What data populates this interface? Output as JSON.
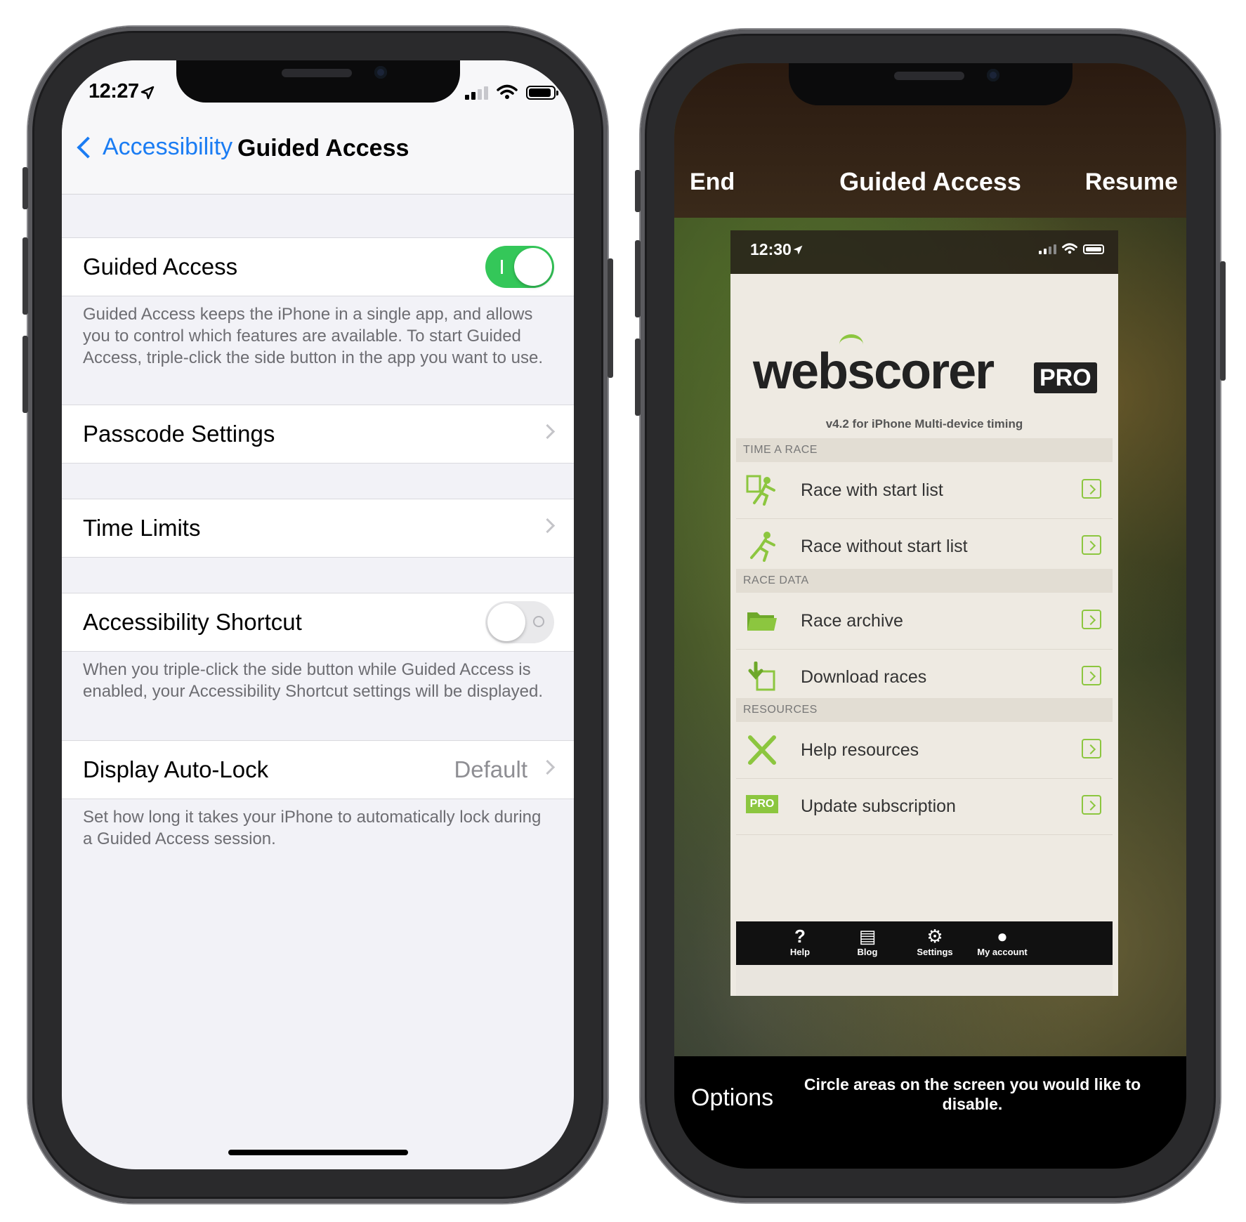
{
  "left_phone": {
    "status": {
      "time": "12:27"
    },
    "nav": {
      "back_label": "Accessibility",
      "title": "Guided Access"
    },
    "guided_access": {
      "label": "Guided Access",
      "enabled": true
    },
    "guided_access_footer": "Guided Access keeps the iPhone in a single app, and allows you to control which features are available. To start Guided Access, triple-click the side button in the app you want to use.",
    "passcode_settings": {
      "label": "Passcode Settings"
    },
    "time_limits": {
      "label": "Time Limits"
    },
    "accessibility_shortcut": {
      "label": "Accessibility Shortcut",
      "enabled": false
    },
    "accessibility_shortcut_footer": "When you triple-click the side button while Guided Access is enabled, your Accessibility Shortcut settings will be displayed.",
    "display_auto_lock": {
      "label": "Display Auto-Lock",
      "value": "Default"
    },
    "display_auto_lock_footer": "Set how long it takes your iPhone to automatically lock during a Guided Access session."
  },
  "right_phone": {
    "top": {
      "end": "End",
      "title": "Guided Access",
      "resume": "Resume"
    },
    "bottom": {
      "options": "Options",
      "hint": "Circle areas on the screen you would like to disable."
    },
    "inner_status": {
      "time": "12:30"
    },
    "app": {
      "logo_text": "webscorer",
      "pro_badge": "PRO",
      "version": "v4.2 for iPhone Multi-device timing",
      "sections": [
        {
          "title": "TIME A RACE",
          "items": [
            "Race with start list",
            "Race without start list"
          ]
        },
        {
          "title": "RACE DATA",
          "items": [
            "Race archive",
            "Download races"
          ]
        },
        {
          "title": "RESOURCES",
          "items": [
            "Help resources",
            "Update subscription"
          ]
        }
      ],
      "pro_icon_label": "PRO",
      "tabs": [
        {
          "label": "Help",
          "icon": "question-icon"
        },
        {
          "label": "Blog",
          "icon": "blog-icon"
        },
        {
          "label": "Settings",
          "icon": "gear-icon"
        },
        {
          "label": "My account",
          "icon": "person-icon"
        }
      ]
    }
  },
  "colors": {
    "ios_blue": "#1a7cf3",
    "toggle_green": "#34c759",
    "webscorer_green": "#8cc63f"
  }
}
